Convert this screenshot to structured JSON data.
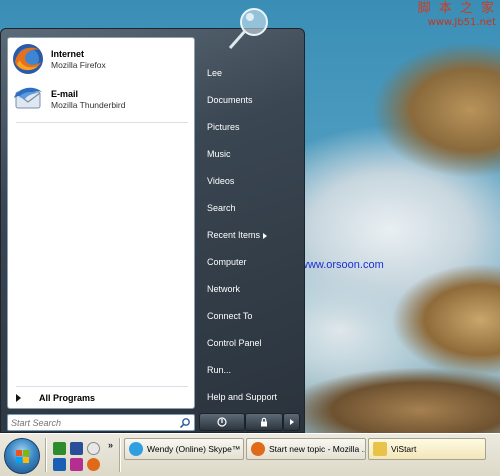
{
  "watermark": {
    "top_cn": "脚 本 之 家",
    "top_url": "www.Jb51.net",
    "middle": "www.orsoon.com"
  },
  "start_menu": {
    "pinned": [
      {
        "name": "Internet",
        "description": "Mozilla Firefox",
        "icon": "firefox-icon"
      },
      {
        "name": "E-mail",
        "description": "Mozilla Thunderbird",
        "icon": "thunderbird-icon"
      }
    ],
    "all_programs_label": "All Programs",
    "search_placeholder": "Start Search",
    "right_items": [
      {
        "label": "Lee"
      },
      {
        "label": "Documents"
      },
      {
        "label": "Pictures"
      },
      {
        "label": "Music"
      },
      {
        "label": "Videos"
      },
      {
        "label": "Search"
      },
      {
        "label": "Recent Items",
        "has_submenu": true
      },
      {
        "label": "Computer"
      },
      {
        "label": "Network"
      },
      {
        "label": "Connect To"
      },
      {
        "label": "Control Panel"
      },
      {
        "label": "Run..."
      },
      {
        "label": "Help and Support"
      }
    ],
    "power_buttons": [
      "power-icon",
      "lock-icon",
      "arrow-right-icon"
    ]
  },
  "taskbar": {
    "chevron": "»",
    "tasks": [
      {
        "label": "Wendy (Online) Skype™ ...",
        "icon": "skype-icon",
        "active": false
      },
      {
        "label": "Start new topic - Mozilla ...",
        "icon": "firefox-icon",
        "active": false
      },
      {
        "label": "ViStart",
        "icon": "folder-icon",
        "active": true
      }
    ]
  },
  "colors": {
    "menu_dark": "#2a333c",
    "watermark_red": "#d23a1e",
    "watermark_blue": "#1a2fd6"
  }
}
